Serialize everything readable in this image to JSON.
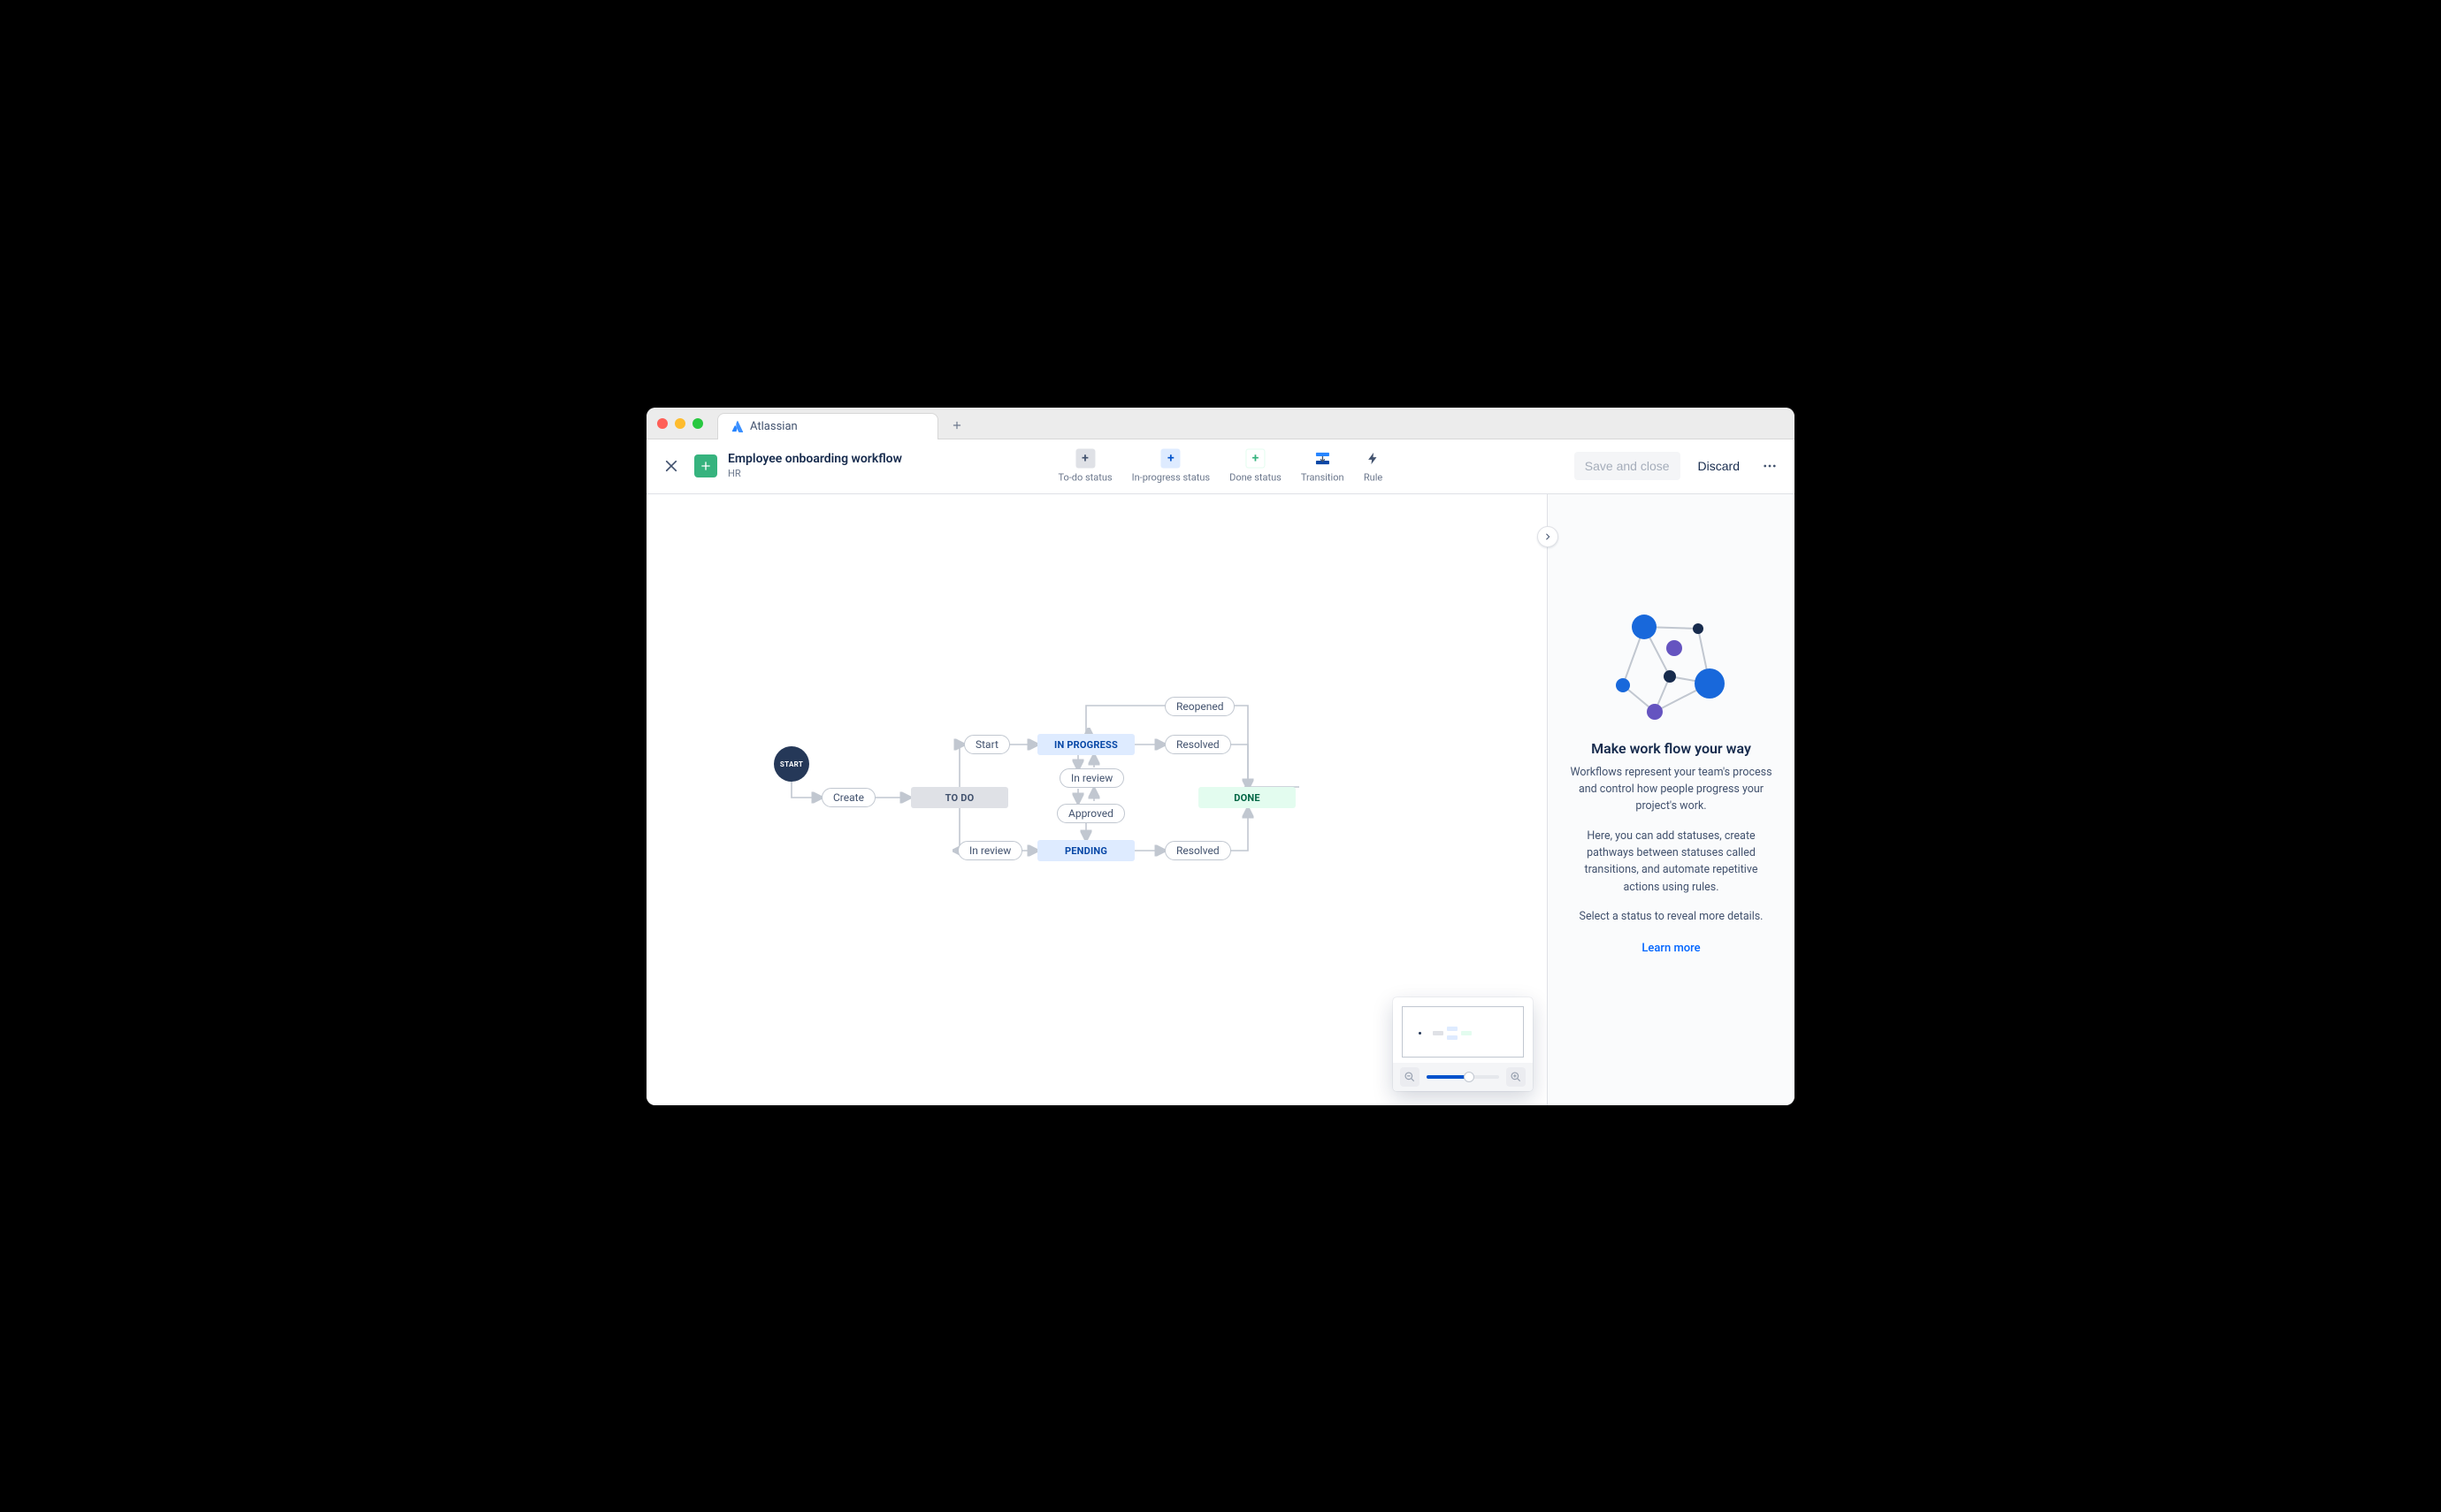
{
  "browser": {
    "tab_label": "Atlassian"
  },
  "header": {
    "title": "Employee onboarding workflow",
    "subtitle": "HR",
    "tools": {
      "todo": "To-do status",
      "inprog": "In-progress status",
      "done": "Done status",
      "transition": "Transition",
      "rule": "Rule"
    },
    "save_label": "Save and close",
    "discard_label": "Discard"
  },
  "workflow": {
    "start_label": "START",
    "statuses": {
      "todo": "TO DO",
      "inprog": "IN PROGRESS",
      "pending": "PENDING",
      "done": "DONE"
    },
    "transitions": {
      "create": "Create",
      "start": "Start",
      "in_review1": "In review",
      "reopened": "Reopened",
      "resolved1": "Resolved",
      "approved": "Approved",
      "in_review2": "In review",
      "resolved2": "Resolved"
    }
  },
  "side": {
    "heading": "Make work flow your way",
    "p1": "Workflows represent your team's process and control how people progress your project's work.",
    "p2": "Here, you can add statuses, create pathways between statuses called transitions, and automate repetitive actions using rules.",
    "p3": "Select a status to reveal more details.",
    "learn_more": "Learn more"
  }
}
